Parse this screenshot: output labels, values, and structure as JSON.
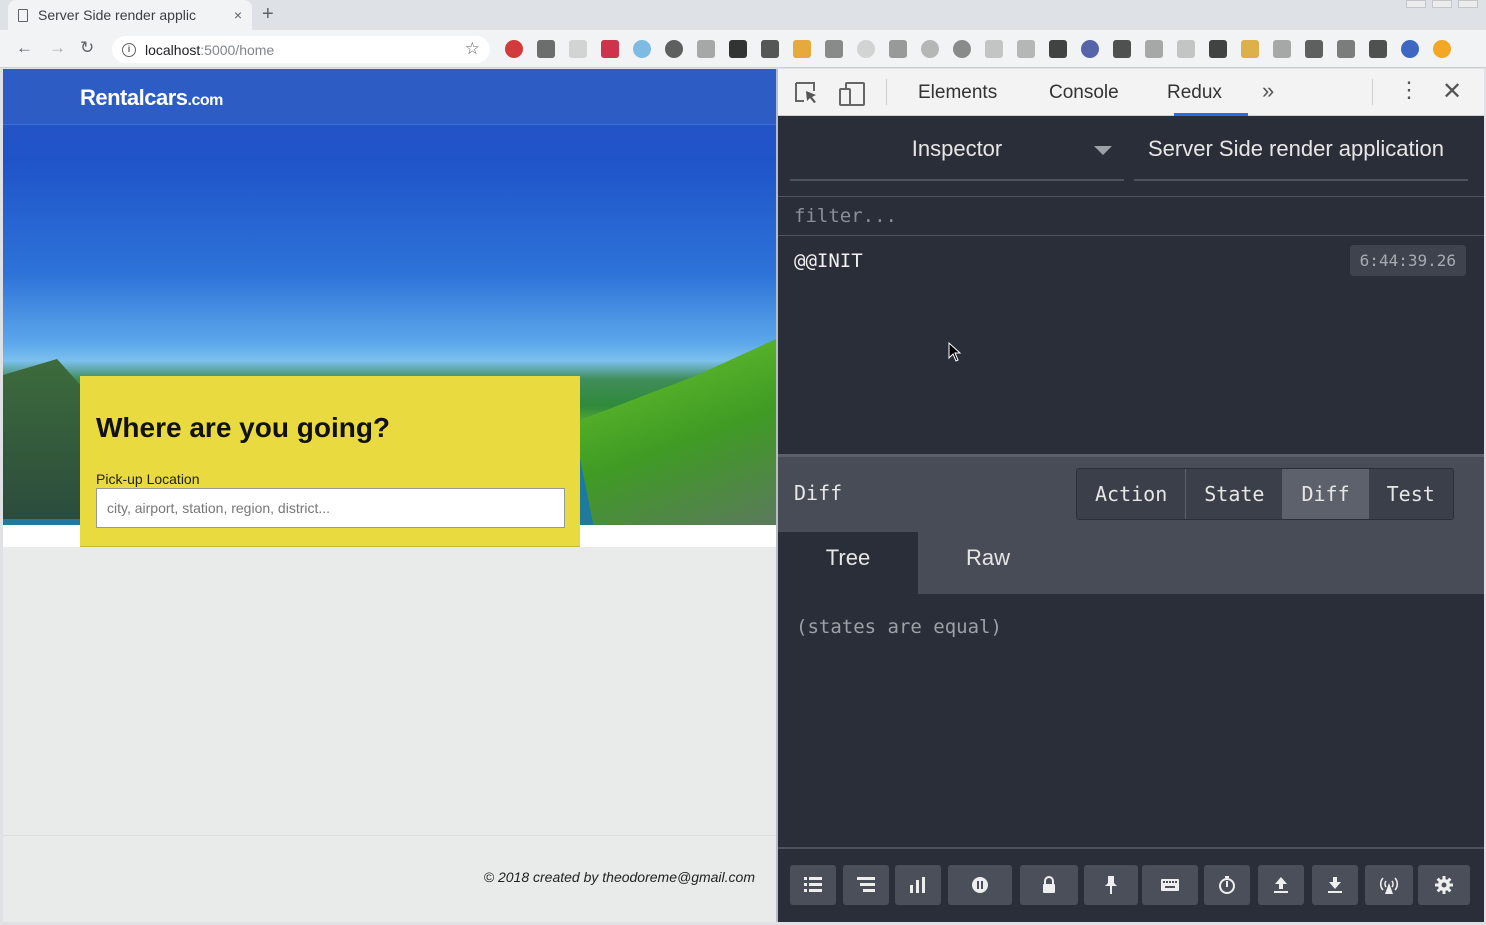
{
  "browser": {
    "tab_title": "Server Side render applic",
    "tab_close": "×",
    "new_tab": "+",
    "url_host": "localhost",
    "url_path": ":5000/home"
  },
  "page": {
    "logo_main": "Rentalcars",
    "logo_suffix": ".com",
    "heading": "Where are you going?",
    "pickup_label": "Pick-up Location",
    "pickup_placeholder": "city, airport, station, region, district...",
    "footer": "© 2018 created by theodoreme@gmail.com"
  },
  "devtools": {
    "tabs": [
      "Elements",
      "Console",
      "Redux"
    ],
    "active_tab": "Redux",
    "more": "»",
    "kebab": "⋮",
    "close": "✕",
    "monitor": "Inspector",
    "instance": "Server Side render application",
    "filter_placeholder": "filter...",
    "actions": [
      {
        "name": "@@INIT",
        "time": "6:44:39.26"
      }
    ],
    "diff_title": "Diff",
    "view_tabs": [
      "Action",
      "State",
      "Diff",
      "Test"
    ],
    "active_view": "Diff",
    "sub_tabs": [
      "Tree",
      "Raw"
    ],
    "active_sub": "Tree",
    "diff_message": "(states are equal)",
    "bottom_buttons": [
      "log-monitor-icon",
      "inspector-icon",
      "chart-icon",
      "pause-icon",
      "lock-icon",
      "pin-icon",
      "keyboard-icon",
      "timer-icon",
      "upload-icon",
      "download-icon",
      "remote-icon",
      "gear-icon"
    ]
  },
  "colors": {
    "site_header": "#2c5cc4",
    "search_panel": "#e8da3f",
    "devtools_bg": "#2a2e38",
    "active_tab_underline": "#1a73e8"
  }
}
